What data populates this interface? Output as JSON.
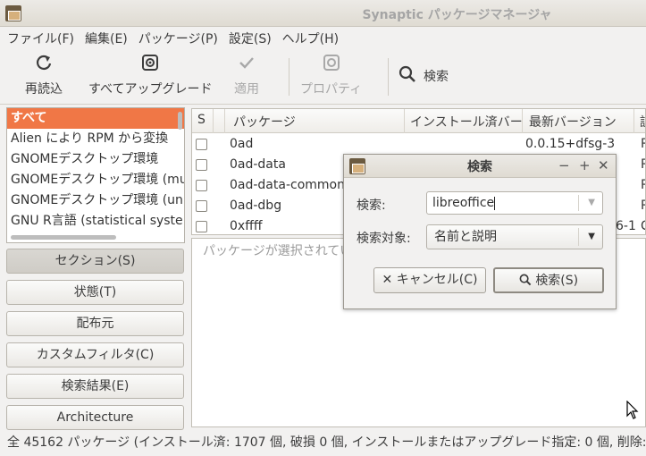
{
  "window": {
    "title": "Synaptic パッケージマネージャ"
  },
  "menu": [
    "ファイル(F)",
    "編集(E)",
    "パッケージ(P)",
    "設定(S)",
    "ヘルプ(H)"
  ],
  "toolbar": {
    "reload": "再読込",
    "upgrade_all": "すべてアップグレード",
    "apply": "適用",
    "properties": "プロパティ",
    "search": "検索"
  },
  "filters": [
    "すべて",
    "Alien により RPM から変換",
    "GNOMEデスクトップ環境",
    "GNOMEデスクトップ環境 (mu",
    "GNOMEデスクトップ環境 (un",
    "GNU R言語 (statistical syste"
  ],
  "side_buttons": [
    "セクション(S)",
    "状態(T)",
    "配布元",
    "カスタムフィルタ(C)",
    "検索結果(E)",
    "Architecture"
  ],
  "table": {
    "headers": {
      "s": "S",
      "package": "パッケージ",
      "installed": "インストール済バー",
      "latest": "最新バージョン",
      "desc": "説"
    },
    "rows": [
      {
        "name": "0ad",
        "latest": "0.0.15+dfsg-3",
        "extra": "R"
      },
      {
        "name": "0ad-data",
        "latest": "",
        "extra": "R"
      },
      {
        "name": "0ad-data-common",
        "latest": "",
        "extra": "R"
      },
      {
        "name": "0ad-dbg",
        "latest": "",
        "extra": "R"
      },
      {
        "name": "0xffff",
        "latest": "6-1",
        "extra": "C"
      }
    ]
  },
  "desc_placeholder": "パッケージが選択されていません",
  "status": "全 45162 パッケージ (インストール済: 1707 個, 破損 0 個, インストールまたはアップグレード指定: 0 個, 削除: 0 個",
  "dialog": {
    "title": "検索",
    "search_label": "検索:",
    "search_value": "libreoffice",
    "target_label": "検索対象:",
    "target_value": "名前と説明",
    "cancel": "キャンセル(C)",
    "search_button": "検索(S)"
  }
}
